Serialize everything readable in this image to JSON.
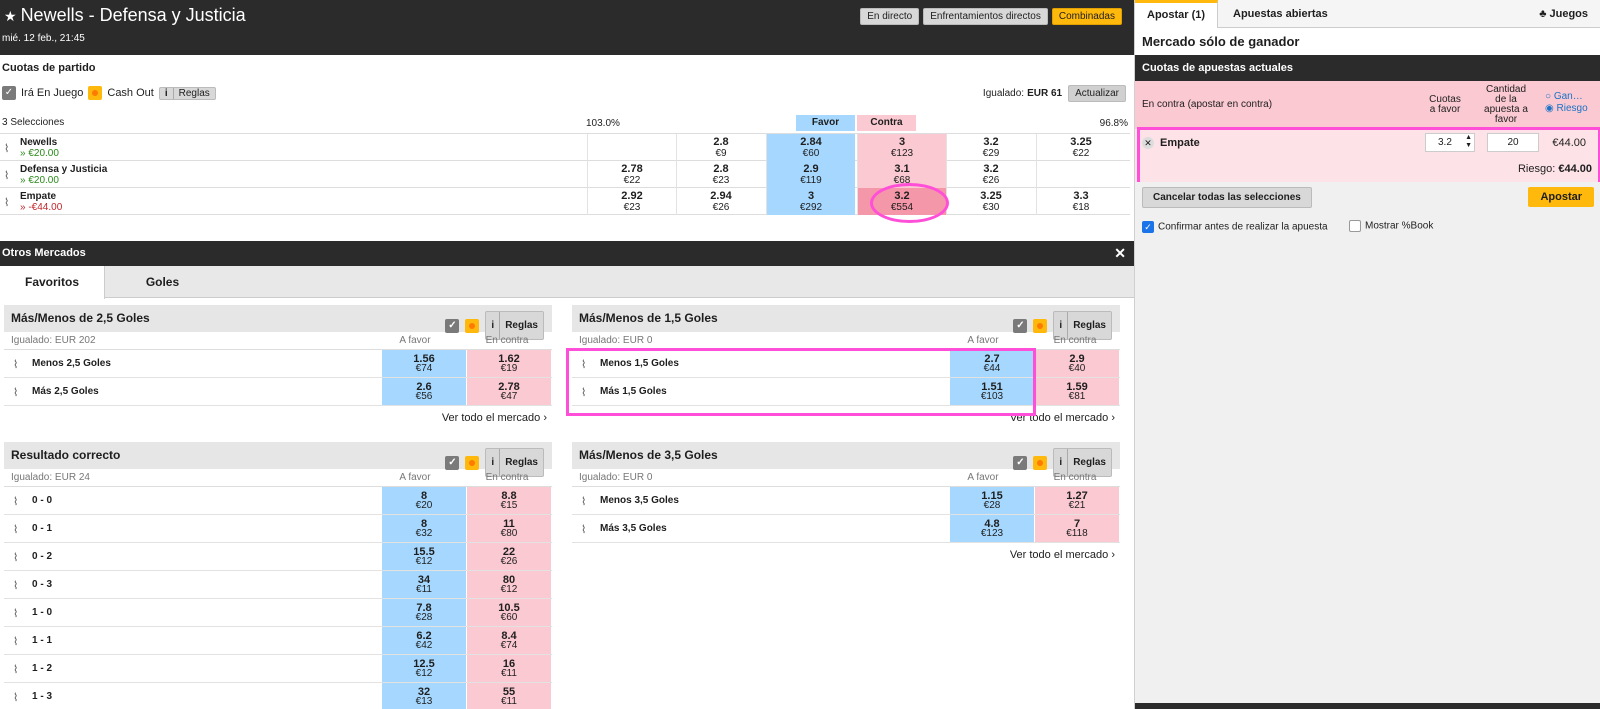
{
  "event": {
    "title": "Newells - Defensa y Justicia",
    "date": "mié. 12 feb., 21:45"
  },
  "top_buttons": {
    "live": "En directo",
    "h2h": "Enfrentamientos directos",
    "combo": "Combinadas"
  },
  "match_odds": {
    "title": "Cuotas de partido",
    "inplay": "Irá En Juego",
    "cashout": "Cash Out",
    "rules": "Reglas",
    "matched_label": "Igualado:",
    "matched_value": "EUR 61",
    "refresh": "Actualizar",
    "selections": "3 Selecciones",
    "back_pct": "103.0%",
    "lay_pct": "96.8%",
    "favor": "Favor",
    "contra": "Contra",
    "runners": [
      {
        "name": "Newells",
        "pl": "» €20.00",
        "cells": [
          [
            "",
            ""
          ],
          [
            "2.8",
            "€9"
          ],
          [
            "2.84",
            "€60"
          ],
          [
            "3",
            "€123"
          ],
          [
            "3.2",
            "€29"
          ],
          [
            "3.25",
            "€22"
          ]
        ]
      },
      {
        "name": "Defensa y Justicia",
        "pl": "» €20.00",
        "cells": [
          [
            "2.78",
            "€22"
          ],
          [
            "2.8",
            "€23"
          ],
          [
            "2.9",
            "€119"
          ],
          [
            "3.1",
            "€68"
          ],
          [
            "3.2",
            "€26"
          ],
          [
            "",
            ""
          ]
        ]
      },
      {
        "name": "Empate",
        "pl": "» -€44.00",
        "cells": [
          [
            "2.92",
            "€23"
          ],
          [
            "2.94",
            "€26"
          ],
          [
            "3",
            "€292"
          ],
          [
            "3.2",
            "€554"
          ],
          [
            "3.25",
            "€30"
          ],
          [
            "3.3",
            "€18"
          ]
        ]
      }
    ]
  },
  "other_markets": {
    "title": "Otros Mercados",
    "tabs": [
      "Favoritos",
      "Goles"
    ],
    "col_favor": "A favor",
    "col_contra": "En contra",
    "see_all": "Ver todo el mercado",
    "markets": [
      {
        "title": "Más/Menos de 2,5 Goles",
        "matched": "Igualado: EUR 202",
        "rows": [
          {
            "name": "Menos 2,5 Goles",
            "b": "1.56",
            "bs": "€74",
            "l": "1.62",
            "ls": "€19"
          },
          {
            "name": "Más 2,5 Goles",
            "b": "2.6",
            "bs": "€56",
            "l": "2.78",
            "ls": "€47"
          }
        ]
      },
      {
        "title": "Más/Menos de 1,5 Goles",
        "matched": "Igualado: EUR 0",
        "rows": [
          {
            "name": "Menos 1,5 Goles",
            "b": "2.7",
            "bs": "€44",
            "l": "2.9",
            "ls": "€40"
          },
          {
            "name": "Más 1,5 Goles",
            "b": "1.51",
            "bs": "€103",
            "l": "1.59",
            "ls": "€81"
          }
        ]
      },
      {
        "title": "Resultado correcto",
        "matched": "Igualado: EUR 24",
        "rows": [
          {
            "name": "0 - 0",
            "b": "8",
            "bs": "€20",
            "l": "8.8",
            "ls": "€15"
          },
          {
            "name": "0 - 1",
            "b": "8",
            "bs": "€32",
            "l": "11",
            "ls": "€80"
          },
          {
            "name": "0 - 2",
            "b": "15.5",
            "bs": "€12",
            "l": "22",
            "ls": "€26"
          },
          {
            "name": "0 - 3",
            "b": "34",
            "bs": "€11",
            "l": "80",
            "ls": "€12"
          },
          {
            "name": "1 - 0",
            "b": "7.8",
            "bs": "€28",
            "l": "10.5",
            "ls": "€60"
          },
          {
            "name": "1 - 1",
            "b": "6.2",
            "bs": "€42",
            "l": "8.4",
            "ls": "€74"
          },
          {
            "name": "1 - 2",
            "b": "12.5",
            "bs": "€12",
            "l": "16",
            "ls": "€11"
          },
          {
            "name": "1 - 3",
            "b": "32",
            "bs": "€13",
            "l": "55",
            "ls": "€11"
          }
        ]
      },
      {
        "title": "Más/Menos de 3,5 Goles",
        "matched": "Igualado: EUR 0",
        "rows": [
          {
            "name": "Menos 3,5 Goles",
            "b": "1.15",
            "bs": "€28",
            "l": "1.27",
            "ls": "€21"
          },
          {
            "name": "Más 3,5 Goles",
            "b": "4.8",
            "bs": "€123",
            "l": "7",
            "ls": "€118"
          }
        ]
      }
    ]
  },
  "betslip": {
    "tabs": {
      "place": "Apostar (1)",
      "open": "Apuestas abiertas",
      "games": "Juegos"
    },
    "market": "Mercado sólo de ganador",
    "current": "Cuotas de apuestas actuales",
    "lay_label": "En contra (apostar en contra)",
    "col_odds": "Cuotas a favor",
    "col_stake": "Cantidad de la apuesta a favor",
    "radio_win": "Gan…",
    "radio_risk": "Riesgo",
    "selection": "Empate",
    "odds": "3.2",
    "stake": "20",
    "liability": "€44.00",
    "risk_label": "Riesgo:",
    "risk_value": "€44.00",
    "cancel": "Cancelar todas las selecciones",
    "place": "Apostar",
    "confirm": "Confirmar antes de realizar la apuesta",
    "book": "Mostrar %Book"
  },
  "colors": {
    "back": "#a6d8ff",
    "lay": "#fac9d1",
    "accent": "#ffb80c",
    "highlight": "#ff4fd8"
  }
}
